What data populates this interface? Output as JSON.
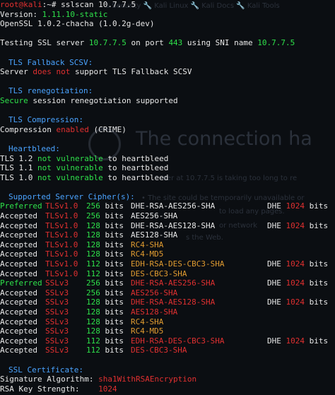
{
  "background_page": {
    "tabs_text": "s Security  🔧 Kali Linux  🔧 Kali Docs  🔧 Kali Tools",
    "heading": "The connection ha",
    "lines": [
      "ver at 10.7.7.5 is taking too long to re",
      "•  The site could be temporarily unavailable or",
      "to load any pages.",
      "or network",
      "s the Web."
    ]
  },
  "prompt": {
    "user_host": "root@kali",
    "path": ":~# ",
    "command": "sslscan 10.7.7.5"
  },
  "version_label": "Version: ",
  "version_value": "1.11.10-static",
  "openssl_line": "OpenSSL 1.0.2-chacha (1.0.2g-dev)",
  "testing": {
    "prefix": "Testing SSL server ",
    "host": "10.7.7.5",
    "on_port": " on port ",
    "port": "443",
    "using_sni": " using SNI name ",
    "sni": "10.7.7.5"
  },
  "fallback": {
    "title": "TLS Fallback SCSV:",
    "line_a": "Server ",
    "does_not": "does not",
    "line_b": " support TLS Fallback SCSV"
  },
  "renegotiation": {
    "title": "TLS renegotiation:",
    "secure": "Secure",
    "rest": " session renegotiation supported"
  },
  "compression": {
    "title": "TLS Compression:",
    "label": "Compression ",
    "enabled": "enabled",
    "crime": " (CRIME)"
  },
  "heartbleed": {
    "title": "Heartbleed:",
    "rows": [
      {
        "proto": "TLS 1.2 ",
        "status": "not vulnerable",
        "suffix": " to heartbleed"
      },
      {
        "proto": "TLS 1.1 ",
        "status": "not vulnerable",
        "suffix": " to heartbleed"
      },
      {
        "proto": "TLS 1.0 ",
        "status": "not vulnerable",
        "suffix": " to heartbleed"
      }
    ]
  },
  "ciphers": {
    "title": "Supported Server Cipher(s):",
    "bits_label": "bits",
    "rows": [
      {
        "status": "Preferred",
        "status_color": "g",
        "proto": "TLSv1.0",
        "proto_color": "r",
        "bits": "256",
        "bits_color": "g",
        "cipher": "DHE-RSA-AES256-SHA",
        "cipher_color": "w",
        "dhe": "DHE",
        "dhe_bits": "1024"
      },
      {
        "status": "Accepted",
        "status_color": "w",
        "proto": "TLSv1.0",
        "proto_color": "r",
        "bits": "256",
        "bits_color": "g",
        "cipher": "AES256-SHA",
        "cipher_color": "w",
        "dhe": "",
        "dhe_bits": ""
      },
      {
        "status": "Accepted",
        "status_color": "w",
        "proto": "TLSv1.0",
        "proto_color": "r",
        "bits": "128",
        "bits_color": "g",
        "cipher": "DHE-RSA-AES128-SHA",
        "cipher_color": "w",
        "dhe": "DHE",
        "dhe_bits": "1024"
      },
      {
        "status": "Accepted",
        "status_color": "w",
        "proto": "TLSv1.0",
        "proto_color": "r",
        "bits": "128",
        "bits_color": "g",
        "cipher": "AES128-SHA",
        "cipher_color": "w",
        "dhe": "",
        "dhe_bits": ""
      },
      {
        "status": "Accepted",
        "status_color": "w",
        "proto": "TLSv1.0",
        "proto_color": "r",
        "bits": "128",
        "bits_color": "g",
        "cipher": "RC4-SHA",
        "cipher_color": "o",
        "dhe": "",
        "dhe_bits": ""
      },
      {
        "status": "Accepted",
        "status_color": "w",
        "proto": "TLSv1.0",
        "proto_color": "r",
        "bits": "128",
        "bits_color": "g",
        "cipher": "RC4-MD5",
        "cipher_color": "o",
        "dhe": "",
        "dhe_bits": ""
      },
      {
        "status": "Accepted",
        "status_color": "w",
        "proto": "TLSv1.0",
        "proto_color": "r",
        "bits": "112",
        "bits_color": "g",
        "cipher": "EDH-RSA-DES-CBC3-SHA",
        "cipher_color": "o",
        "dhe": "DHE",
        "dhe_bits": "1024"
      },
      {
        "status": "Accepted",
        "status_color": "w",
        "proto": "TLSv1.0",
        "proto_color": "r",
        "bits": "112",
        "bits_color": "g",
        "cipher": "DES-CBC3-SHA",
        "cipher_color": "o",
        "dhe": "",
        "dhe_bits": ""
      },
      {
        "status": "Preferred",
        "status_color": "g",
        "proto": "SSLv3",
        "proto_color": "r",
        "bits": "256",
        "bits_color": "g",
        "cipher": "DHE-RSA-AES256-SHA",
        "cipher_color": "r",
        "dhe": "DHE",
        "dhe_bits": "1024"
      },
      {
        "status": "Accepted",
        "status_color": "w",
        "proto": "SSLv3",
        "proto_color": "r",
        "bits": "256",
        "bits_color": "g",
        "cipher": "AES256-SHA",
        "cipher_color": "r",
        "dhe": "",
        "dhe_bits": ""
      },
      {
        "status": "Accepted",
        "status_color": "w",
        "proto": "SSLv3",
        "proto_color": "r",
        "bits": "128",
        "bits_color": "g",
        "cipher": "DHE-RSA-AES128-SHA",
        "cipher_color": "r",
        "dhe": "DHE",
        "dhe_bits": "1024"
      },
      {
        "status": "Accepted",
        "status_color": "w",
        "proto": "SSLv3",
        "proto_color": "r",
        "bits": "128",
        "bits_color": "g",
        "cipher": "AES128-SHA",
        "cipher_color": "r",
        "dhe": "",
        "dhe_bits": ""
      },
      {
        "status": "Accepted",
        "status_color": "w",
        "proto": "SSLv3",
        "proto_color": "r",
        "bits": "128",
        "bits_color": "g",
        "cipher": "RC4-SHA",
        "cipher_color": "o",
        "dhe": "",
        "dhe_bits": ""
      },
      {
        "status": "Accepted",
        "status_color": "w",
        "proto": "SSLv3",
        "proto_color": "r",
        "bits": "128",
        "bits_color": "g",
        "cipher": "RC4-MD5",
        "cipher_color": "o",
        "dhe": "",
        "dhe_bits": ""
      },
      {
        "status": "Accepted",
        "status_color": "w",
        "proto": "SSLv3",
        "proto_color": "r",
        "bits": "112",
        "bits_color": "g",
        "cipher": "EDH-RSA-DES-CBC3-SHA",
        "cipher_color": "r",
        "dhe": "DHE",
        "dhe_bits": "1024"
      },
      {
        "status": "Accepted",
        "status_color": "w",
        "proto": "SSLv3",
        "proto_color": "r",
        "bits": "112",
        "bits_color": "g",
        "cipher": "DES-CBC3-SHA",
        "cipher_color": "r",
        "dhe": "",
        "dhe_bits": ""
      }
    ]
  },
  "certificate": {
    "title": "SSL Certificate:",
    "sig_label": "Signature Algorithm: ",
    "sig_value": "sha1WithRSAEncryption",
    "key_label": "RSA Key Strength:    ",
    "key_value": "1024"
  },
  "colors": {
    "green": "#2ee04a",
    "red": "#e03030",
    "orange": "#e09b30",
    "blue": "#4aa3ff",
    "background": "#0b0e12"
  }
}
